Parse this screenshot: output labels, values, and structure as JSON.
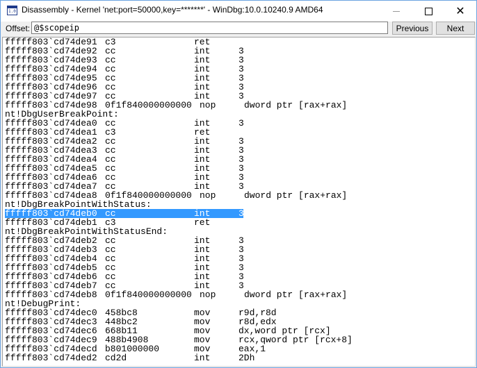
{
  "window": {
    "title": "Disassembly - Kernel 'net:port=50000,key=*******' - WinDbg:10.0.10240.9 AMD64",
    "icon": "disassembly-window-icon",
    "icon_text": "1.0",
    "controls": [
      "minimize",
      "maximize",
      "close"
    ]
  },
  "toolbar": {
    "offset_label": "Offset:",
    "offset_value": "@$scopeip",
    "previous_label": "Previous",
    "next_label": "Next"
  },
  "disassembly": {
    "selected_index": 20,
    "lines": [
      {
        "type": "instr",
        "addr": "fffff803`cd74de91",
        "bytes": "c3",
        "mnemonic": "ret",
        "operands": ""
      },
      {
        "type": "instr",
        "addr": "fffff803`cd74de92",
        "bytes": "cc",
        "mnemonic": "int",
        "operands": "3"
      },
      {
        "type": "instr",
        "addr": "fffff803`cd74de93",
        "bytes": "cc",
        "mnemonic": "int",
        "operands": "3"
      },
      {
        "type": "instr",
        "addr": "fffff803`cd74de94",
        "bytes": "cc",
        "mnemonic": "int",
        "operands": "3"
      },
      {
        "type": "instr",
        "addr": "fffff803`cd74de95",
        "bytes": "cc",
        "mnemonic": "int",
        "operands": "3"
      },
      {
        "type": "instr",
        "addr": "fffff803`cd74de96",
        "bytes": "cc",
        "mnemonic": "int",
        "operands": "3"
      },
      {
        "type": "instr",
        "addr": "fffff803`cd74de97",
        "bytes": "cc",
        "mnemonic": "int",
        "operands": "3"
      },
      {
        "type": "instr",
        "addr": "fffff803`cd74de98",
        "bytes": "0f1f840000000000",
        "mnemonic": "nop",
        "operands": "dword ptr [rax+rax]"
      },
      {
        "type": "label",
        "text": "nt!DbgUserBreakPoint:"
      },
      {
        "type": "instr",
        "addr": "fffff803`cd74dea0",
        "bytes": "cc",
        "mnemonic": "int",
        "operands": "3"
      },
      {
        "type": "instr",
        "addr": "fffff803`cd74dea1",
        "bytes": "c3",
        "mnemonic": "ret",
        "operands": ""
      },
      {
        "type": "instr",
        "addr": "fffff803`cd74dea2",
        "bytes": "cc",
        "mnemonic": "int",
        "operands": "3"
      },
      {
        "type": "instr",
        "addr": "fffff803`cd74dea3",
        "bytes": "cc",
        "mnemonic": "int",
        "operands": "3"
      },
      {
        "type": "instr",
        "addr": "fffff803`cd74dea4",
        "bytes": "cc",
        "mnemonic": "int",
        "operands": "3"
      },
      {
        "type": "instr",
        "addr": "fffff803`cd74dea5",
        "bytes": "cc",
        "mnemonic": "int",
        "operands": "3"
      },
      {
        "type": "instr",
        "addr": "fffff803`cd74dea6",
        "bytes": "cc",
        "mnemonic": "int",
        "operands": "3"
      },
      {
        "type": "instr",
        "addr": "fffff803`cd74dea7",
        "bytes": "cc",
        "mnemonic": "int",
        "operands": "3"
      },
      {
        "type": "instr",
        "addr": "fffff803`cd74dea8",
        "bytes": "0f1f840000000000",
        "mnemonic": "nop",
        "operands": "dword ptr [rax+rax]"
      },
      {
        "type": "label",
        "text": "nt!DbgBreakPointWithStatus:"
      },
      {
        "type": "instr",
        "addr": "fffff803`cd74deb0",
        "bytes": "cc",
        "mnemonic": "int",
        "operands": "3",
        "selected": true
      },
      {
        "type": "instr",
        "addr": "fffff803`cd74deb1",
        "bytes": "c3",
        "mnemonic": "ret",
        "operands": ""
      },
      {
        "type": "label",
        "text": "nt!DbgBreakPointWithStatusEnd:"
      },
      {
        "type": "instr",
        "addr": "fffff803`cd74deb2",
        "bytes": "cc",
        "mnemonic": "int",
        "operands": "3"
      },
      {
        "type": "instr",
        "addr": "fffff803`cd74deb3",
        "bytes": "cc",
        "mnemonic": "int",
        "operands": "3"
      },
      {
        "type": "instr",
        "addr": "fffff803`cd74deb4",
        "bytes": "cc",
        "mnemonic": "int",
        "operands": "3"
      },
      {
        "type": "instr",
        "addr": "fffff803`cd74deb5",
        "bytes": "cc",
        "mnemonic": "int",
        "operands": "3"
      },
      {
        "type": "instr",
        "addr": "fffff803`cd74deb6",
        "bytes": "cc",
        "mnemonic": "int",
        "operands": "3"
      },
      {
        "type": "instr",
        "addr": "fffff803`cd74deb7",
        "bytes": "cc",
        "mnemonic": "int",
        "operands": "3"
      },
      {
        "type": "instr",
        "addr": "fffff803`cd74deb8",
        "bytes": "0f1f840000000000",
        "mnemonic": "nop",
        "operands": "dword ptr [rax+rax]"
      },
      {
        "type": "label",
        "text": "nt!DebugPrint:"
      },
      {
        "type": "instr",
        "addr": "fffff803`cd74dec0",
        "bytes": "458bc8",
        "mnemonic": "mov",
        "operands": "r9d,r8d"
      },
      {
        "type": "instr",
        "addr": "fffff803`cd74dec3",
        "bytes": "448bc2",
        "mnemonic": "mov",
        "operands": "r8d,edx"
      },
      {
        "type": "instr",
        "addr": "fffff803`cd74dec6",
        "bytes": "668b11",
        "mnemonic": "mov",
        "operands": "dx,word ptr [rcx]"
      },
      {
        "type": "instr",
        "addr": "fffff803`cd74dec9",
        "bytes": "488b4908",
        "mnemonic": "mov",
        "operands": "rcx,qword ptr [rcx+8]"
      },
      {
        "type": "instr",
        "addr": "fffff803`cd74decd",
        "bytes": "b801000000",
        "mnemonic": "mov",
        "operands": "eax,1"
      },
      {
        "type": "instr",
        "addr": "fffff803`cd74ded2",
        "bytes": "cd2d",
        "mnemonic": "int",
        "operands": "2Dh"
      }
    ]
  },
  "colors": {
    "selection": "#3399ff",
    "window_border": "#6aa3e0"
  }
}
